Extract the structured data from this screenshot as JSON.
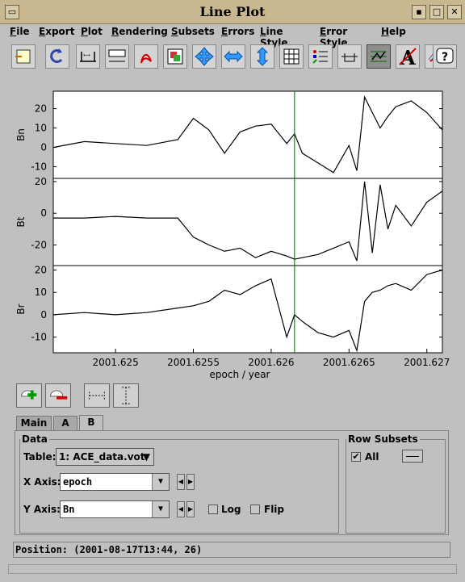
{
  "window": {
    "title": "Line Plot",
    "controls": [
      "menu",
      "minimize",
      "maximize",
      "close"
    ]
  },
  "menu": [
    "File",
    "Export",
    "Plot",
    "Rendering",
    "Subsets",
    "Errors",
    "Line Style",
    "Error Style",
    "Help"
  ],
  "toolbar": {
    "icons": [
      "window-icon",
      "replot-icon",
      "axis-edit-icon",
      "title-icon",
      "pdf-export-icon",
      "image-export-icon",
      "resize-both-icon",
      "resize-horizontal-icon",
      "resize-vertical-icon",
      "grid-icon",
      "legend-icon",
      "zero-line-icon",
      "line-mode-icon",
      "antialias-icon",
      "marker-icon",
      "help-icon"
    ],
    "pressed": [
      "line-mode-icon"
    ],
    "accent_color": "#3399ff"
  },
  "chart_data": {
    "type": "line",
    "shared_x_axis": {
      "label": "epoch / year",
      "ticks": [
        "2001.625",
        "2001.6255",
        "2001.626",
        "2001.6265",
        "2001.627"
      ],
      "range": [
        2001.6246,
        2001.6271
      ]
    },
    "marker_line": {
      "x": 2001.62615,
      "color": "#006600"
    },
    "line_color": "#000000",
    "grid": false,
    "series": [
      {
        "name": "Bn",
        "ylabel": "Bn",
        "ylim": [
          -16,
          29
        ],
        "yticks": [
          20,
          10,
          0,
          -10
        ],
        "x": [
          2001.6246,
          2001.6248,
          2001.625,
          2001.6252,
          2001.6254,
          2001.6255,
          2001.6256,
          2001.6257,
          2001.6258,
          2001.6259,
          2001.626,
          2001.6261,
          2001.62615,
          2001.6262,
          2001.6263,
          2001.6264,
          2001.6265,
          2001.62655,
          2001.6266,
          2001.62665,
          2001.6267,
          2001.62675,
          2001.6268,
          2001.6269,
          2001.627,
          2001.6271
        ],
        "y": [
          0,
          3,
          2,
          1,
          4,
          15,
          9,
          -3,
          8,
          11,
          12,
          2,
          7,
          -3,
          -8,
          -13,
          1,
          -12,
          26,
          18,
          10,
          16,
          21,
          24,
          18,
          9
        ]
      },
      {
        "name": "Bt",
        "ylabel": "Bt",
        "ylim": [
          -33,
          22
        ],
        "yticks": [
          20,
          0,
          -20
        ],
        "x": [
          2001.6246,
          2001.6248,
          2001.625,
          2001.6252,
          2001.6254,
          2001.6255,
          2001.6256,
          2001.6257,
          2001.6258,
          2001.6259,
          2001.626,
          2001.6261,
          2001.62615,
          2001.6262,
          2001.6263,
          2001.6264,
          2001.6265,
          2001.62655,
          2001.6266,
          2001.62665,
          2001.6267,
          2001.62675,
          2001.6268,
          2001.6269,
          2001.627,
          2001.6271
        ],
        "y": [
          -3,
          -3,
          -2,
          -3,
          -3,
          -15,
          -20,
          -24,
          -22,
          -28,
          -24,
          -27,
          -29,
          -28,
          -26,
          -22,
          -18,
          -30,
          20,
          -25,
          18,
          -10,
          5,
          -8,
          7,
          14
        ]
      },
      {
        "name": "Br",
        "ylabel": "Br",
        "ylim": [
          -17,
          22
        ],
        "yticks": [
          20,
          10,
          0,
          -10
        ],
        "x": [
          2001.6246,
          2001.6248,
          2001.625,
          2001.6252,
          2001.6254,
          2001.6255,
          2001.6256,
          2001.6257,
          2001.6258,
          2001.6259,
          2001.626,
          2001.6261,
          2001.62615,
          2001.6262,
          2001.6263,
          2001.6264,
          2001.6265,
          2001.62655,
          2001.6266,
          2001.62665,
          2001.6267,
          2001.62675,
          2001.6268,
          2001.6269,
          2001.627,
          2001.6271
        ],
        "y": [
          0,
          1,
          0,
          1,
          3,
          4,
          6,
          11,
          9,
          13,
          16,
          -10,
          0,
          -3,
          -8,
          -10,
          -7,
          -16,
          6,
          10,
          11,
          13,
          14,
          11,
          18,
          20
        ]
      }
    ]
  },
  "subset_buttons": [
    "add-subset-icon",
    "remove-subset-icon",
    "x-range-icon",
    "y-range-icon"
  ],
  "tabs": [
    "Main",
    "A",
    "B"
  ],
  "active_tab": "B",
  "data_panel": {
    "legend": "Data",
    "table_label": "Table:",
    "table_value": "1: ACE_data.vot",
    "x_label": "X Axis:",
    "x_value": "epoch",
    "y_label": "Y Axis:",
    "y_value": "Bn",
    "log_label": "Log",
    "log_checked": false,
    "flip_label": "Flip",
    "flip_checked": false
  },
  "row_subsets": {
    "legend": "Row Subsets",
    "all_label": "All",
    "all_checked": true
  },
  "status": {
    "position": "Position: (2001-08-17T13:44, 26)"
  }
}
